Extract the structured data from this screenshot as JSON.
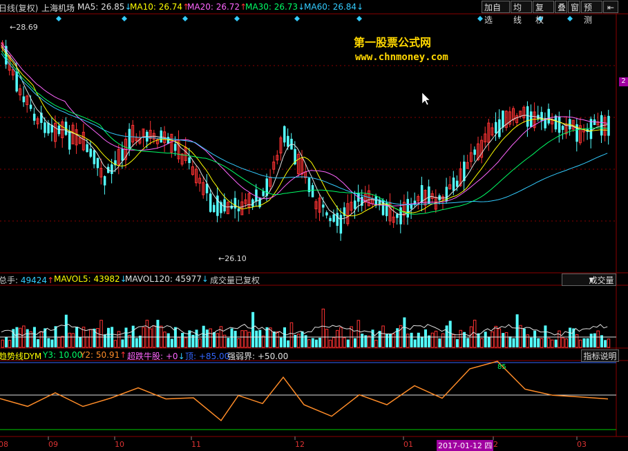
{
  "header": {
    "period": "日线(复权)",
    "stock_name": "上海机场",
    "ma5": {
      "label": "MA5:",
      "value": "26.85",
      "arrow": "↓",
      "color": "#e0e0e0"
    },
    "ma10": {
      "label": "MA10:",
      "value": "26.74",
      "arrow": "↑",
      "color": "#ffff00"
    },
    "ma20": {
      "label": "MA20:",
      "value": "26.72",
      "arrow": "↑",
      "color": "#ff66ff"
    },
    "ma30": {
      "label": "MA30:",
      "value": "26.73",
      "arrow": "↓",
      "color": "#00ff66"
    },
    "ma60": {
      "label": "MA60:",
      "value": "26.84",
      "arrow": "↓",
      "color": "#33ccff"
    },
    "buttons": [
      "加自选",
      "均线",
      "复权",
      "叠",
      "窗",
      "预测"
    ],
    "fullscreen_icon": "arrow-left-bar-icon"
  },
  "price": {
    "high_label": "28.69",
    "low_label": "26.10",
    "right_tick": "2"
  },
  "watermark": {
    "title": "第一股票公式网",
    "url": "www.chnmoney.com"
  },
  "volume": {
    "total": {
      "label": "总手:",
      "value": "49424",
      "arrow": "↑"
    },
    "mavol5": {
      "label": "MAVOL5:",
      "value": "43982",
      "arrow": "↓"
    },
    "mavol120": {
      "label": "MAVOL120:",
      "value": "45977",
      "arrow": "↓"
    },
    "note": "成交量已复权",
    "indicator_button": "成交量"
  },
  "indicator": {
    "name": "趋势线DYM",
    "y3": {
      "label": "Y3:",
      "value": "10.00"
    },
    "y2": {
      "label": "Y2:",
      "value": "50.91",
      "arrow": "↑"
    },
    "bull": {
      "label": "超跌牛股:",
      "value": "+0",
      "arrow": "↓"
    },
    "top": {
      "label": "顶:",
      "value": "+85.00"
    },
    "boundary": {
      "label": "强弱界:",
      "value": "+50.00"
    },
    "peak_label": "85",
    "help_button": "指标说明"
  },
  "x_axis": {
    "labels": [
      "08",
      "09",
      "10",
      "11",
      "12",
      "01",
      "2017-01-12 四",
      "2",
      "03"
    ]
  },
  "colors": {
    "up": "#ff3333",
    "down": "#54ffff",
    "grid": "#8b0000",
    "orange": "#ff8c28"
  }
}
